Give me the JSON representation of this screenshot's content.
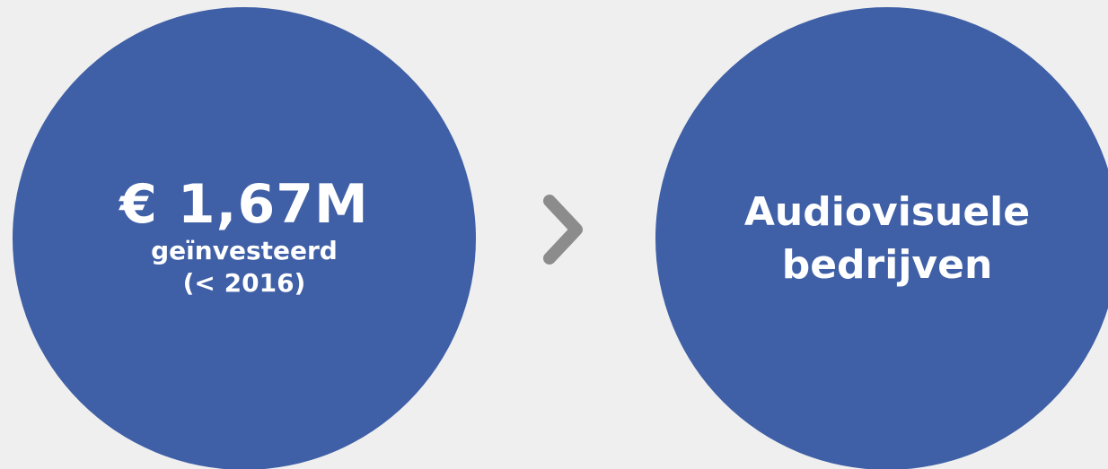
{
  "colors": {
    "background": "#efefef",
    "circle": "#3f5fa6",
    "text": "#ffffff",
    "arrow": "#8c8c8c"
  },
  "left_node": {
    "amount": "€ 1,67M",
    "line1": "geïnvesteerd",
    "line2": "(< 2016)"
  },
  "connector": {
    "icon": "chevron-right-icon"
  },
  "right_node": {
    "line1": "Audiovisuele",
    "line2": "bedrijven"
  }
}
